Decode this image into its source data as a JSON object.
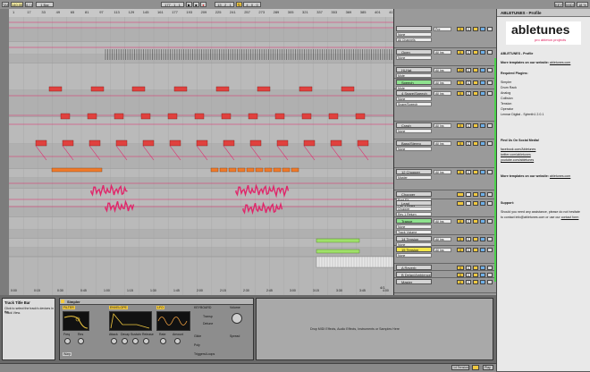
{
  "transport": {
    "tap": "TAP",
    "tempo": "140.00",
    "signature": "4 / 4",
    "position": "177 . 1 . 1",
    "loop_start": "13 . 2 . 1",
    "loop_length": "4 . 0 . 0",
    "key": "KEY",
    "midi": "MIDI",
    "cpu": "18 %"
  },
  "ruler": {
    "bars": [
      "1",
      "17",
      "33",
      "49",
      "65",
      "81",
      "97",
      "113",
      "129",
      "145",
      "161",
      "177",
      "193",
      "209",
      "225",
      "241",
      "257",
      "273",
      "289",
      "305",
      "321",
      "337",
      "353",
      "369",
      "385",
      "401",
      "417"
    ],
    "times": [
      "0:00",
      "0:15",
      "0:30",
      "0:45",
      "1:00",
      "1:15",
      "1:30",
      "1:45",
      "2:00",
      "2:15",
      "2:30",
      "2:45",
      "3:00",
      "3:15",
      "3:30",
      "3:45",
      "4:00"
    ],
    "loop_readout": "4/1"
  },
  "tracks": [
    {
      "name": "",
      "label_a": "None",
      "label_b": "All Channels",
      "chain": "Pre",
      "sel": "All Ins",
      "vol": "0",
      "pan": "C",
      "color": ""
    },
    {
      "name": "Open",
      "label_a": "None",
      "label_b": "",
      "chain": "All Ins",
      "sel": "",
      "vol": "0",
      "pan": "C",
      "color": ""
    },
    {
      "name": "Hi-Hat",
      "label_a": "Mute",
      "label_b": "Speaker On",
      "chain": "All Ins",
      "sel": "",
      "vol": "-10",
      "pan": "C",
      "color": ""
    },
    {
      "name": "Speech",
      "label_a": "Mute",
      "label_b": "Speaker On",
      "chain": "All Ins",
      "sel": "",
      "vol": "0",
      "pan": "C",
      "color": "green"
    },
    {
      "name": "4 Snare/Speech",
      "label_a": "None",
      "label_b": "Snare/Speech",
      "chain": "All Ins",
      "sel": "",
      "vol": "0",
      "pan": "C",
      "color": ""
    },
    {
      "name": "Crash",
      "label_a": "None",
      "label_b": "",
      "chain": "All Ins",
      "sel": "",
      "vol": "0",
      "pan": "C",
      "color": ""
    },
    {
      "name": "Bass/Stereo",
      "label_a": "None",
      "label_b": "",
      "chain": "All Ins",
      "sel": "",
      "vol": "0",
      "pan": "C",
      "color": ""
    },
    {
      "name": "12 Chopper",
      "label_a": "Master",
      "label_b": "",
      "chain": "All Ins",
      "sel": "",
      "vol": "0",
      "pan": "C",
      "color": ""
    },
    {
      "name": "Chopper",
      "label_a": "Post FX",
      "label_b": "Pan 1 Delay",
      "chain": "",
      "sel": "",
      "vol": "",
      "pan": "",
      "color": ""
    },
    {
      "name": "Lead",
      "label_a": "Chopper",
      "label_b": "Rev 1 Return",
      "chain": "",
      "sel": "",
      "vol": "",
      "pan": "",
      "color": ""
    },
    {
      "name": "Trance",
      "label_a": "None",
      "label_b": "Track Volume",
      "chain": "All Ins",
      "sel": "",
      "vol": "0",
      "pan": "C",
      "color": "green"
    },
    {
      "name": "14 Tension",
      "label_a": "None",
      "label_b": "",
      "chain": "All Ins",
      "sel": "",
      "vol": "0",
      "pan": "C",
      "color": ""
    },
    {
      "name": "15 Tension",
      "label_a": "None",
      "label_b": "",
      "chain": "All Ins",
      "sel": "",
      "vol": "0",
      "pan": "C",
      "color": "yellow"
    },
    {
      "name": "A Reverb",
      "label_a": "",
      "label_b": "",
      "chain": "",
      "sel": "",
      "vol": "0",
      "pan": "C",
      "color": ""
    },
    {
      "name": "B Delay/Ambience",
      "label_a": "",
      "label_b": "",
      "chain": "",
      "sel": "",
      "vol": "0",
      "pan": "C",
      "color": ""
    },
    {
      "name": "Master",
      "label_a": "",
      "label_b": "",
      "chain": "",
      "sel": "",
      "vol": "0",
      "pan": "C",
      "color": ""
    }
  ],
  "help": {
    "title": "ABLETUNES - Profile",
    "logo_main": "abletunes",
    "logo_sub": "pro ableton projects",
    "section_title": "ABLETUNES - Profile",
    "more_templates": "More templates on our website:",
    "site": "abletunes.com",
    "required_title": "Required Plugins:",
    "plugins": [
      "Simpler",
      "Drum Rack",
      "Analog",
      "Collision",
      "Tension",
      "Operator",
      "Lennar Digital - Sylenth1 2.0.1"
    ],
    "social_title": "Find Us On Social Media!",
    "social": [
      "facebook.com/Abletunes",
      "twitter.com/abletunes",
      "youtube.com/abletunes"
    ],
    "support_title": "Support:",
    "support_text_1": "Should you need any assistance, please do not hesitate",
    "support_text_2": "to contact info@abletunes.com or use our",
    "support_link": "contact form"
  },
  "info_view": {
    "title": "Track Title Bar",
    "text_1": "Click to select the track's devices in the",
    "text_2": "Track View."
  },
  "device": {
    "name": "Simpler",
    "filter": "FILTER",
    "env": "ENVELOPE",
    "lfo": "LFO",
    "keyboard": "KEYBOARD",
    "glide": "Glide",
    "poly": "Poly",
    "volume": "Volume",
    "spread": "Spread",
    "labels": [
      "Freq",
      "Res",
      "Attack",
      "Decay",
      "Sustain",
      "Release",
      "Rate",
      "Amount",
      "Transp",
      "Detune"
    ],
    "warp": "Warp",
    "params": "Triggers/Loops"
  },
  "drop_hint": "Drop MIDI Effects, Audio Effects, Instruments or Samples Here",
  "status": {
    "track_label": "14 Tension",
    "mode": "Play"
  },
  "colors": {
    "clip_red": "#e0413e",
    "clip_orange": "#f07a2a",
    "env_pink": "#e0266a",
    "clip_green": "#9fe06a"
  }
}
